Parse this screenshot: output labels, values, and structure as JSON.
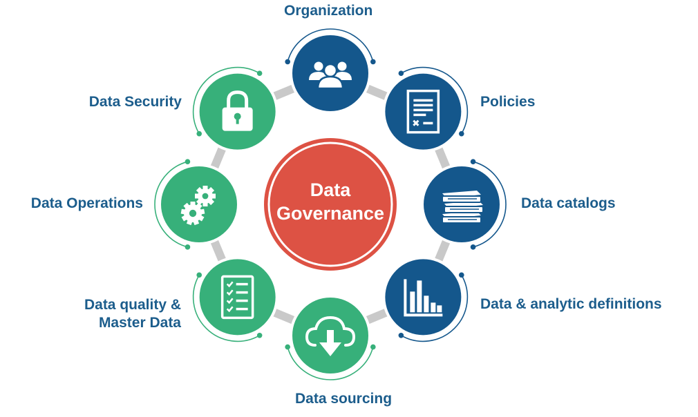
{
  "center": {
    "line1": "Data",
    "line2": "Governance",
    "color": "#dd5244"
  },
  "colors": {
    "blue": "#14578c",
    "green": "#37b07a",
    "label": "#1c5d8c",
    "connector": "#c9c9c9"
  },
  "nodes": [
    {
      "id": "organization",
      "label": [
        "Organization"
      ],
      "icon": "people-icon",
      "color": "blue"
    },
    {
      "id": "policies",
      "label": [
        "Policies"
      ],
      "icon": "document-icon",
      "color": "blue"
    },
    {
      "id": "data-catalogs",
      "label": [
        "Data catalogs"
      ],
      "icon": "books-icon",
      "color": "blue"
    },
    {
      "id": "data-analytic-definitions",
      "label": [
        "Data & analytic definitions"
      ],
      "icon": "bar-chart-icon",
      "color": "blue"
    },
    {
      "id": "data-sourcing",
      "label": [
        "Data sourcing"
      ],
      "icon": "cloud-download-icon",
      "color": "green"
    },
    {
      "id": "data-quality",
      "label": [
        "Data quality &",
        "Master Data"
      ],
      "icon": "checklist-icon",
      "color": "green"
    },
    {
      "id": "data-operations",
      "label": [
        "Data Operations"
      ],
      "icon": "gears-icon",
      "color": "green"
    },
    {
      "id": "data-security",
      "label": [
        "Data Security"
      ],
      "icon": "padlock-icon",
      "color": "green"
    }
  ]
}
